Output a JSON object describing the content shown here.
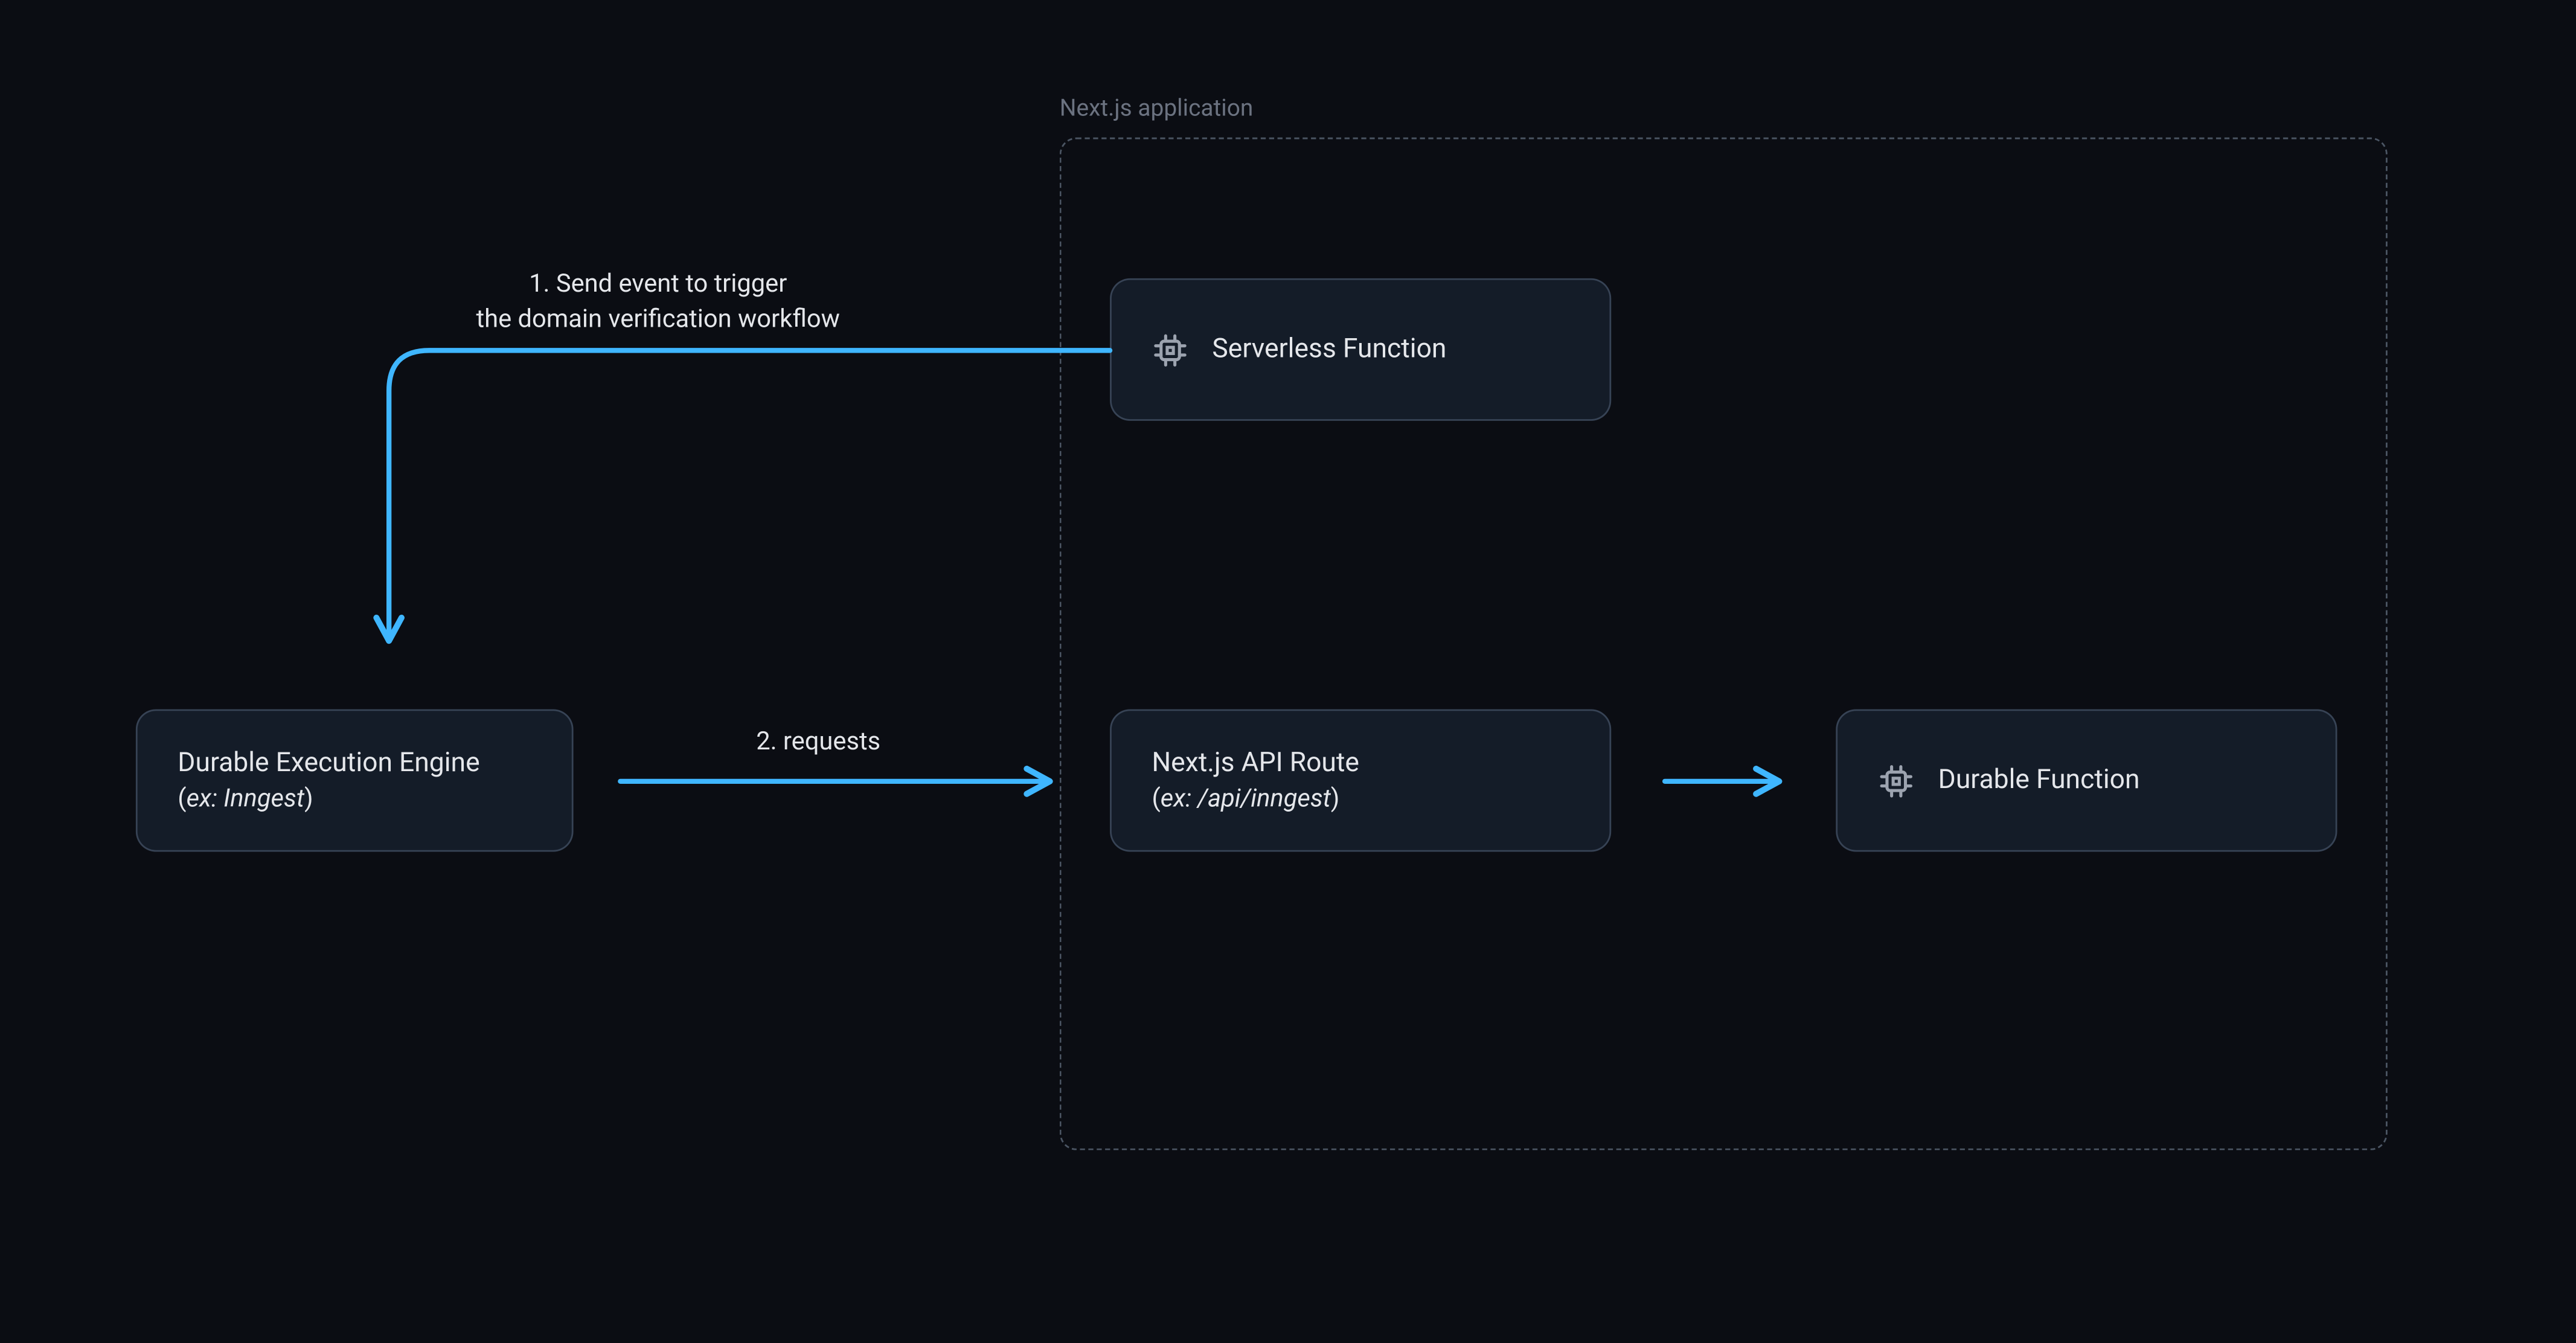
{
  "colors": {
    "background": "#0B0D13",
    "node_bg": "rgba(30,41,59,0.55)",
    "node_border": "rgba(71,85,105,0.7)",
    "container_border": "#4B5563",
    "arrow": "#3FB6FF",
    "text": "#E5E7EB",
    "muted": "#6B7280"
  },
  "container": {
    "label": "Next.js application"
  },
  "nodes": {
    "durable_engine": {
      "title": "Durable Execution Engine",
      "sub_prefix": "(",
      "sub_example": "ex: Inngest",
      "sub_suffix": ")"
    },
    "serverless_fn": {
      "title": "Serverless Function"
    },
    "api_route": {
      "title": "Next.js API Route",
      "sub_prefix": "(",
      "sub_example": "ex: /api/inngest",
      "sub_suffix": ")"
    },
    "durable_fn": {
      "title": "Durable Function"
    }
  },
  "arrows": {
    "a1": {
      "label_line1": "1. Send event to trigger",
      "label_line2": "the domain verification workflow"
    },
    "a2": {
      "label": "2. requests"
    }
  }
}
